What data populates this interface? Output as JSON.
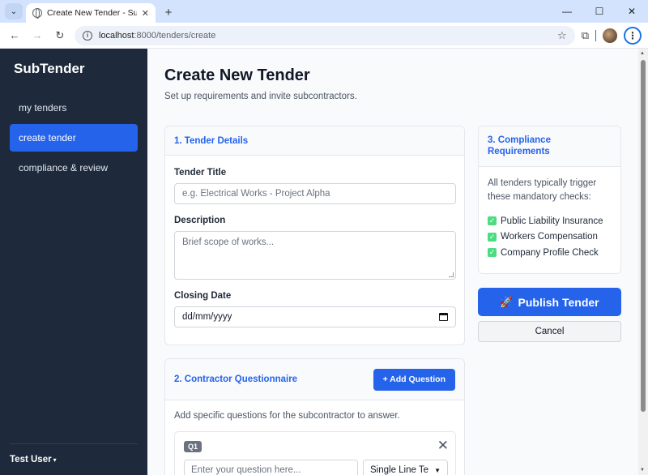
{
  "browser": {
    "tab_title": "Create New Tender - SubTender",
    "tab_close": "✕",
    "new_tab": "+",
    "url_host": "localhost",
    "url_path": ":8000/tenders/create"
  },
  "sidebar": {
    "brand": "SubTender",
    "items": [
      {
        "label": "my tenders",
        "active": false
      },
      {
        "label": "create tender",
        "active": true
      },
      {
        "label": "compliance & review",
        "active": false
      }
    ],
    "user": "Test User"
  },
  "page": {
    "title": "Create New Tender",
    "subtitle": "Set up requirements and invite subcontractors."
  },
  "details": {
    "header": "1. Tender Details",
    "title_label": "Tender Title",
    "title_placeholder": "e.g. Electrical Works - Project Alpha",
    "description_label": "Description",
    "description_placeholder": "Brief scope of works...",
    "closing_label": "Closing Date",
    "closing_value": "dd/mm/yyyy"
  },
  "compliance": {
    "header": "3. Compliance Requirements",
    "intro": "All tenders typically trigger these mandatory checks:",
    "checks": [
      "Public Liability Insurance",
      "Workers Compensation",
      "Company Profile Check"
    ]
  },
  "actions": {
    "publish": "Publish Tender",
    "cancel": "Cancel"
  },
  "questionnaire": {
    "header": "2. Contractor Questionnaire",
    "add_button": "+ Add Question",
    "intro": "Add specific questions for the subcontractor to answer.",
    "question": {
      "badge": "Q1",
      "placeholder": "Enter your question here...",
      "type": "Single Line Te"
    }
  },
  "colors": {
    "sidebar_bg": "#1e293b",
    "accent": "#2563eb",
    "check": "#4ade80"
  }
}
